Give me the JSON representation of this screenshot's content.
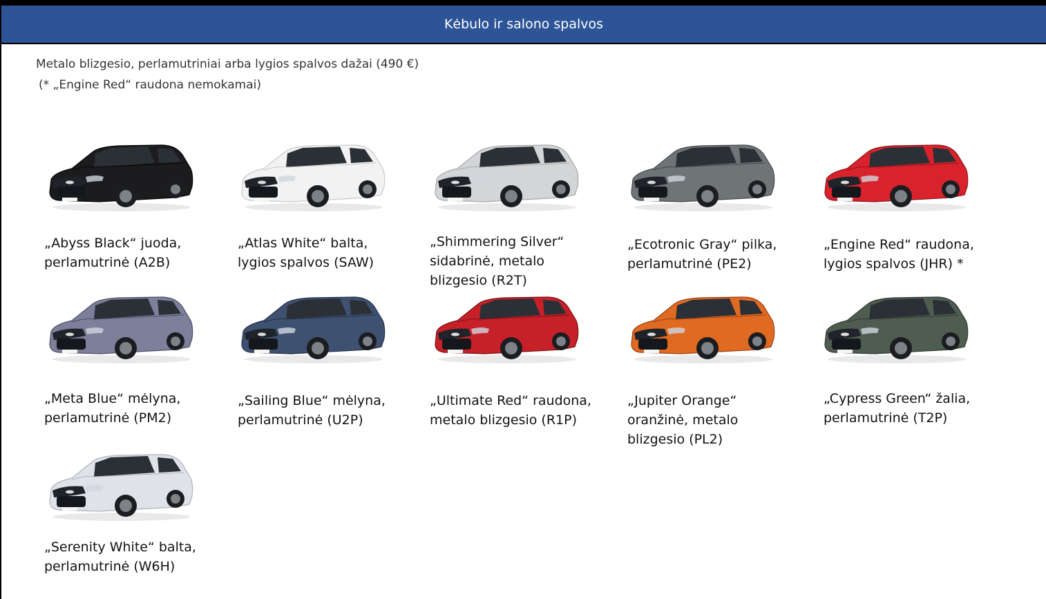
{
  "header": {
    "title": "Kėbulo ir salono spalvos"
  },
  "intro": {
    "line1": "Metalo blizgesio, perlamutriniai arba lygios spalvos dažai (490 €)",
    "line2": "(* „Engine Red“ raudona nemokamai)"
  },
  "colors": [
    {
      "line1": "„Abyss Black“ juoda,",
      "line2": "perlamutrinė (A2B)",
      "line3": "",
      "body": "#1c1c1e",
      "dark": "#050505"
    },
    {
      "line1": "„Atlas White“ balta,",
      "line2": "lygios spalvos (SAW)",
      "line3": "",
      "body": "#f2f2f2",
      "dark": "#c9c9c9"
    },
    {
      "line1": "„Shimmering Silver“",
      "line2": "sidabrinė, metalo",
      "line3": "blizgesio (R2T)",
      "body": "#d4d5d7",
      "dark": "#a4a6a9"
    },
    {
      "line1": "„Ecotronic Gray“ pilka,",
      "line2": "perlamutrinė (PE2)",
      "line3": "",
      "body": "#6f7477",
      "dark": "#44484b"
    },
    {
      "line1": "„Engine Red“ raudona,",
      "line2": "lygios spalvos (JHR) *",
      "line3": "",
      "body": "#d8232c",
      "dark": "#8f1217"
    },
    {
      "line1": "„Meta Blue“ mėlyna,",
      "line2": "perlamutrinė (PM2)",
      "line3": "",
      "body": "#7d7f9b",
      "dark": "#4d4f68"
    },
    {
      "line1": "„Sailing Blue“ mėlyna,",
      "line2": "perlamutrinė (U2P)",
      "line3": "",
      "body": "#3f5170",
      "dark": "#233047"
    },
    {
      "line1": "„Ultimate Red“ raudona,",
      "line2": "metalo blizgesio (R1P)",
      "line3": "",
      "body": "#c62028",
      "dark": "#7c0f14"
    },
    {
      "line1": "„Jupiter Orange“",
      "line2": "oranžinė, metalo",
      "line3": "blizgesio (PL2)",
      "body": "#e06a22",
      "dark": "#9a3d0e"
    },
    {
      "line1": "„Cypress Green“ žalia,",
      "line2": "perlamutrinė (T2P)",
      "line3": "",
      "body": "#4f5d51",
      "dark": "#2f3830"
    },
    {
      "line1": "„Serenity White“ balta,",
      "line2": "perlamutrinė (W6H)",
      "line3": "",
      "body": "#dfe2e8",
      "dark": "#aeb2b9"
    }
  ]
}
